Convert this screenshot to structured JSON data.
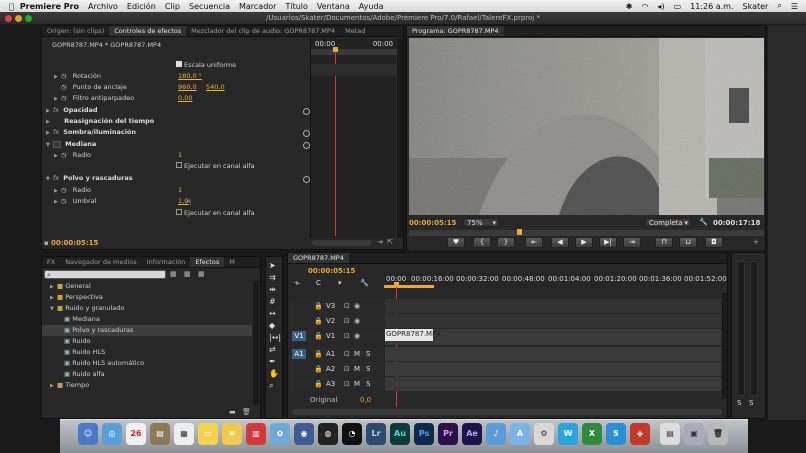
{
  "menubar": {
    "app": "Premiere Pro",
    "items": [
      "Archivo",
      "Edición",
      "Clip",
      "Secuencia",
      "Marcador",
      "Título",
      "Ventana",
      "Ayuda"
    ],
    "time": "11:26 a.m.",
    "user": "Skater"
  },
  "window": {
    "title": "/Usuarios/Skater/Documentos/Adobe/Premiere Pro/7.0/Rafael/TalereFX.prproj *"
  },
  "effects_panel": {
    "tabs": [
      "Origen: (sin clips)",
      "Controles de efectos",
      "Mezclador del clip de audio: GOPR8787.MP4",
      "Metad"
    ],
    "clip_name": "GOPR8787.MP4 * GOPR8787.MP4",
    "ruler_start": "00:00",
    "ruler_end": "00:00",
    "rows": [
      {
        "label": "Escala uniforme",
        "checkbox": true
      },
      {
        "label": "Rotación",
        "value": "180,0 °"
      },
      {
        "label": "Punto de anclaje",
        "value": "960,0",
        "value2": "540,0"
      },
      {
        "label": "Filtro antiparpadeo",
        "value": "0,00"
      },
      {
        "label": "Opacidad",
        "fx": true
      },
      {
        "label": "Reasignación del tiempo"
      },
      {
        "label": "Sombra/iluminación",
        "fx": true
      },
      {
        "label": "Mediana",
        "fx": true
      },
      {
        "label": "Radio",
        "value": "1"
      },
      {
        "label": "Ejecutar en canal alfa",
        "checkbox": true
      },
      {
        "label": "Polvo y rascaduras",
        "fx": true
      },
      {
        "label": "Radio",
        "value": "1"
      },
      {
        "label": "Umbral",
        "value": "1,0"
      },
      {
        "label": "Ejecutar en canal alfa",
        "checkbox": true
      }
    ],
    "timecode": "00:00:05:15"
  },
  "program_monitor": {
    "tab": "Programa: GOPR8787.MP4",
    "timecode": "00:00:05:15",
    "zoom": "75%",
    "quality": "Completa",
    "duration": "00:00:17:18"
  },
  "project_panel": {
    "tabs": [
      "FX",
      "Navegador de medios",
      "Información",
      "Efectos",
      "M"
    ],
    "items": [
      {
        "label": "General",
        "type": "folder"
      },
      {
        "label": "Perspectiva",
        "type": "folder"
      },
      {
        "label": "Ruido y granulado",
        "type": "folder-open"
      },
      {
        "label": "Mediana",
        "type": "effect"
      },
      {
        "label": "Polvo y rascaduras",
        "type": "effect",
        "selected": true
      },
      {
        "label": "Ruido",
        "type": "effect"
      },
      {
        "label": "Ruido HLS",
        "type": "effect"
      },
      {
        "label": "Ruido HLS automático",
        "type": "effect"
      },
      {
        "label": "Ruido alfa",
        "type": "effect"
      },
      {
        "label": "Tiempo",
        "type": "folder"
      }
    ]
  },
  "timeline": {
    "tab": "GOPR8787.MP4",
    "timecode": "00:00:05:15",
    "ruler": [
      "00:00",
      "00:00:16:00",
      "00:00:32:00",
      "00:00:48:00",
      "00:01:04:00",
      "00:01:20:00",
      "00:01:36:00",
      "00:01:52:00"
    ],
    "video_tracks": [
      "V3",
      "V2",
      "V1"
    ],
    "audio_tracks": [
      "A1",
      "A2",
      "A3"
    ],
    "source_v": "V1",
    "source_a": "A1",
    "clip": "GOPR8787.MP4",
    "master": "Original",
    "master_value": "0,0"
  },
  "meters": {
    "labels": [
      "S",
      "S"
    ]
  },
  "dock": [
    "Lr",
    "Au",
    "Ps",
    "Pr",
    "Ae"
  ],
  "colors": {
    "accent": "#e8a83a",
    "playhead": "#dd3333",
    "panel": "#282828"
  }
}
